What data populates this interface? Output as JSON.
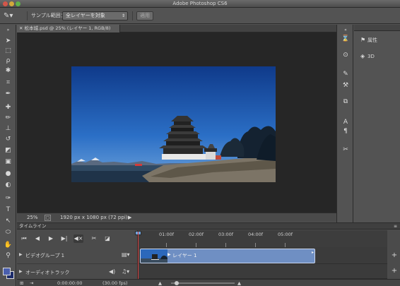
{
  "window": {
    "title": "Adobe Photoshop CS6"
  },
  "options_bar": {
    "tool_icon": "spot-healing-brush-icon",
    "sample_label": "サンプル範囲：",
    "sample_select": "全レイヤーを対象",
    "action_button": "適用"
  },
  "document": {
    "tab_label": "松本城.psd @ 25% (レイヤー 1, RGB/8)",
    "zoom": "25%",
    "doc_info": "1920 px x 1080 px (72 ppi)"
  },
  "toolbar": {
    "tools": [
      "move-tool-icon",
      "marquee-tool-icon",
      "lasso-tool-icon",
      "quick-select-tool-icon",
      "crop-tool-icon",
      "eyedropper-tool-icon",
      "healing-brush-icon",
      "brush-tool-icon",
      "clone-stamp-icon",
      "history-brush-icon",
      "eraser-tool-icon",
      "gradient-tool-icon",
      "blur-tool-icon",
      "dodge-tool-icon",
      "pen-tool-icon",
      "type-tool-icon",
      "path-select-tool-icon",
      "shape-tool-icon",
      "hand-tool-icon",
      "zoom-tool-icon"
    ],
    "foreground_color": "#4a5fae",
    "background_color": "#1d2c6b"
  },
  "right_panel": {
    "items": [
      {
        "icon": "history-icon",
        "label": "属性"
      },
      {
        "icon": "3d-icon",
        "label": "3D"
      }
    ],
    "strip_icons": [
      "history-icon",
      "actions-icon",
      "brush-presets-icon",
      "tool-presets-icon",
      "layer-comps-icon",
      "character-icon",
      "paragraph-icon",
      "swatches-icon"
    ]
  },
  "timeline": {
    "tab_label": "タイムライン",
    "ruler_labels": [
      "01:00f",
      "02:00f",
      "03:00f",
      "04:00f",
      "05:00f"
    ],
    "tracks": [
      {
        "label": "ビデオグループ 1",
        "clip_label": "レイヤー 1"
      },
      {
        "label": "オーディオトラック"
      }
    ],
    "footer": {
      "timecode": "0:00:00:00",
      "fps": "(30.00 fps)"
    }
  }
}
